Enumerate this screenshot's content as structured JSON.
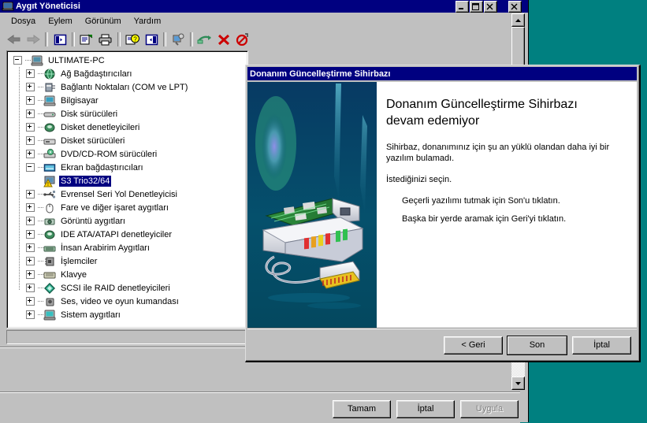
{
  "desktop": {
    "background_color": "#008080"
  },
  "app_window": {
    "title": "Aygıt Yöneticisi",
    "title_icon": "device-manager-icon",
    "controls": {
      "minimize": "minimize-icon",
      "maximize": "maximize-icon",
      "close": "close-icon",
      "outer_close": "close-icon"
    },
    "menu": [
      {
        "label": "Dosya",
        "name": "menu-dosya"
      },
      {
        "label": "Eylem",
        "name": "menu-eylem"
      },
      {
        "label": "Görünüm",
        "name": "menu-gorunum"
      },
      {
        "label": "Yardım",
        "name": "menu-yardim"
      }
    ],
    "toolbar": [
      {
        "name": "back-icon",
        "title": "Geri"
      },
      {
        "name": "forward-icon",
        "title": "İleri"
      },
      {
        "name": "show-hide-tree-icon",
        "title": "Ağacı Göster/Gizle"
      },
      {
        "name": "properties-icon",
        "title": "Özellikler"
      },
      {
        "name": "print-icon",
        "title": "Yazdır"
      },
      {
        "name": "help-icon",
        "title": "Yardım"
      },
      {
        "name": "console-tree-icon",
        "title": "Konsol Ağacı"
      },
      {
        "name": "scan-hardware-icon",
        "title": "Donanım Değişikliklerini Tara"
      },
      {
        "name": "update-driver-icon",
        "title": "Sürücüyü Güncelleştir"
      },
      {
        "name": "uninstall-icon",
        "title": "Kaldır"
      },
      {
        "name": "disable-icon",
        "title": "Devre Dışı Bırak"
      }
    ],
    "tree": {
      "root": {
        "label": "ULTIMATE-PC",
        "icon": "computer-icon",
        "expanded": true
      },
      "items": [
        {
          "label": "Ağ Bağdaştırıcıları",
          "icon": "network-adapter-icon",
          "expanded": false
        },
        {
          "label": "Bağlantı Noktaları (COM ve LPT)",
          "icon": "ports-icon",
          "expanded": false
        },
        {
          "label": "Bilgisayar",
          "icon": "computer-icon",
          "expanded": false
        },
        {
          "label": "Disk sürücüleri",
          "icon": "disk-drive-icon",
          "expanded": false
        },
        {
          "label": "Disket denetleyicileri",
          "icon": "floppy-controller-icon",
          "expanded": false
        },
        {
          "label": "Disket sürücüleri",
          "icon": "floppy-drive-icon",
          "expanded": false
        },
        {
          "label": "DVD/CD-ROM sürücüleri",
          "icon": "cdrom-icon",
          "expanded": false
        },
        {
          "label": "Ekran bağdaştırıcıları",
          "icon": "display-adapter-icon",
          "expanded": true
        },
        {
          "label": "Evrensel Seri Yol Denetleyicisi",
          "icon": "usb-icon",
          "expanded": false
        },
        {
          "label": "Fare ve diğer işaret aygıtları",
          "icon": "mouse-icon",
          "expanded": false
        },
        {
          "label": "Görüntü aygıtları",
          "icon": "imaging-device-icon",
          "expanded": false
        },
        {
          "label": "IDE ATA/ATAPI denetleyiciler",
          "icon": "ide-controller-icon",
          "expanded": false
        },
        {
          "label": "İnsan Arabirim Aygıtları",
          "icon": "hid-icon",
          "expanded": false
        },
        {
          "label": "İşlemciler",
          "icon": "processor-icon",
          "expanded": false
        },
        {
          "label": "Klavye",
          "icon": "keyboard-icon",
          "expanded": false
        },
        {
          "label": "SCSI ile RAID denetleyicileri",
          "icon": "scsi-raid-icon",
          "expanded": false
        },
        {
          "label": "Ses, video ve oyun kumandası",
          "icon": "sound-video-game-icon",
          "expanded": false
        },
        {
          "label": "Sistem aygıtları",
          "icon": "system-device-icon",
          "expanded": false
        }
      ],
      "selected_child": {
        "label": "S3 Trio32/64",
        "icon": "display-adapter-warning-icon",
        "parent": "Ekran bağdaştırıcıları",
        "selected": true,
        "highlight_color": "#000080"
      }
    },
    "buttons": {
      "ok": {
        "label": "Tamam",
        "enabled": true
      },
      "cancel": {
        "label": "İptal",
        "enabled": true
      },
      "apply": {
        "label": "Uygula",
        "enabled": false
      }
    },
    "scrollbar": {
      "up_arrow": "scroll-up-icon",
      "down_arrow": "scroll-down-icon"
    }
  },
  "wizard": {
    "title": "Donanım Güncelleştirme Sihirbazı",
    "heading": "Donanım Güncelleştirme Sihirbazı devam edemiyor",
    "paragraphs": [
      "Sihirbaz, donanımınız için şu an yüklü olandan daha iyi bir yazılım bulamadı.",
      "İstediğinizi seçin."
    ],
    "bullets": [
      "Geçerli yazılımı tutmak için Son'u tıklatın.",
      "Başka bir yerde aramak için Geri'yi tıklatın."
    ],
    "side_image": {
      "name": "hardware-wizard-banner",
      "background_color": "#024a66"
    },
    "buttons": {
      "back": {
        "label": "< Geri",
        "default": false
      },
      "finish": {
        "label": "Son",
        "default": true
      },
      "cancel": {
        "label": "İptal",
        "default": false
      }
    }
  }
}
